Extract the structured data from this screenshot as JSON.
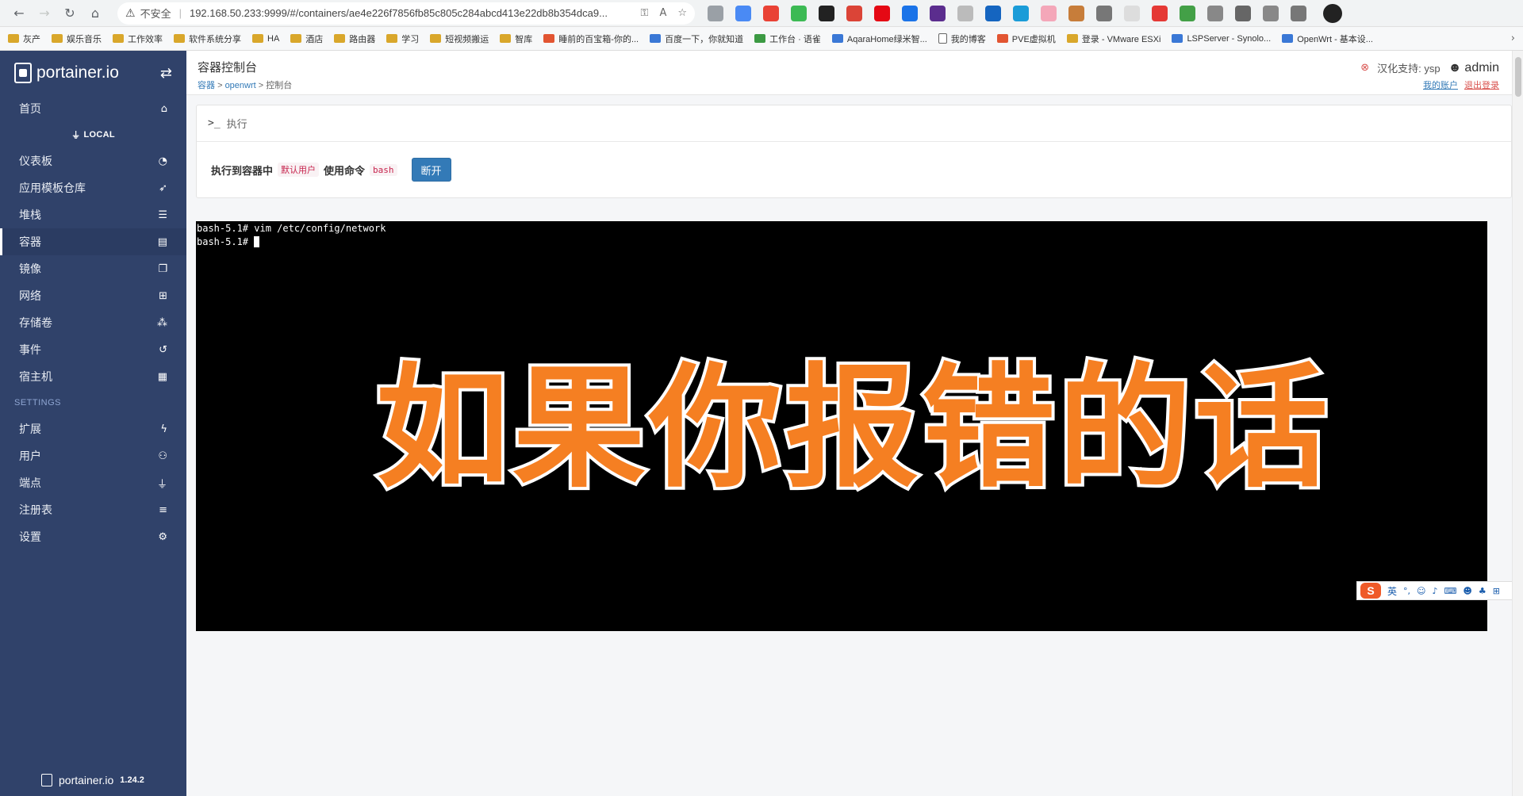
{
  "browser": {
    "security_label": "不安全",
    "url": "192.168.50.233:9999/#/containers/ae4e226f7856fb85c805c284abcd413e22db8b354dca9...",
    "bookmarks": [
      "灰产",
      "娱乐音乐",
      "工作效率",
      "软件系统分享",
      "HA",
      "酒店",
      "路由器",
      "学习",
      "短视频搬运",
      "智库",
      "睡前的百宝箱-你的...",
      "百度一下，你就知道",
      "工作台 · 语雀",
      "AqaraHome绿米智...",
      "我的博客",
      "PVE虚拟机",
      "登录 - VMware ESXi",
      "LSPServer - Synolo...",
      "OpenWrt - 基本设..."
    ]
  },
  "sidebar": {
    "logo": "portainer.io",
    "home_label": "首页",
    "endpoint": "LOCAL",
    "items": [
      "仪表板",
      "应用模板仓库",
      "堆栈",
      "容器",
      "镜像",
      "网络",
      "存储卷",
      "事件",
      "宿主机"
    ],
    "settings_section": "SETTINGS",
    "settings_items": [
      "扩展",
      "用户",
      "端点",
      "注册表",
      "设置"
    ],
    "footer_logo": "portainer.io",
    "version": "1.24.2"
  },
  "header": {
    "title": "容器控制台",
    "breadcrumb": {
      "root": "容器",
      "sep1": ">",
      "container": "openwrt",
      "sep2": ">",
      "current": "控制台"
    },
    "support": "汉化支持: ysp",
    "user": "admin",
    "my_account": "我的账户",
    "logout": "退出登录"
  },
  "exec_panel": {
    "title": "执行",
    "label_exec": "执行到容器中",
    "user_value": "默认用户",
    "label_cmd": "使用命令",
    "cmd_value": "bash",
    "disconnect_label": "断开"
  },
  "terminal": {
    "line1": "bash-5.1# vim /etc/config/network",
    "line2": "bash-5.1# "
  },
  "overlay_text": "如果你报错的话",
  "ime": {
    "logo": "S",
    "lang": "英"
  },
  "colors": {
    "sidebar_bg": "#30426a",
    "primary": "#337ab7",
    "overlay_text": "#f57f22",
    "terminal_bg": "#000000"
  }
}
